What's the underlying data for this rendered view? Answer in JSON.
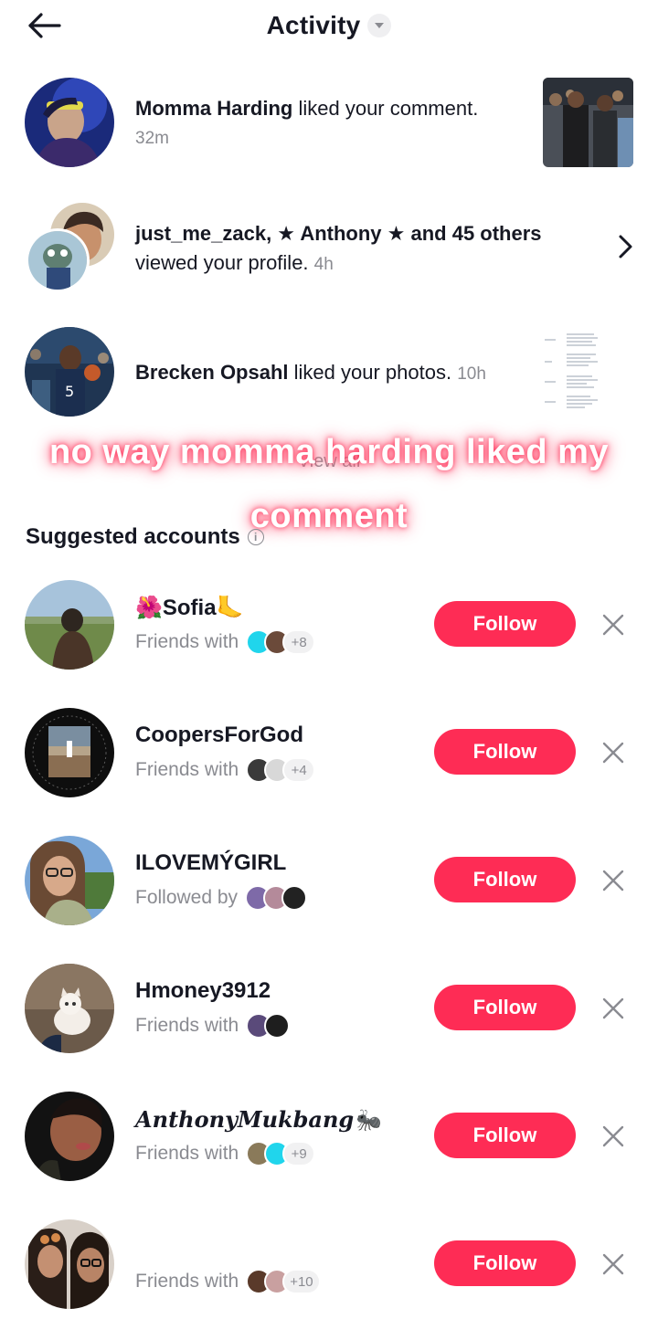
{
  "header": {
    "title": "Activity"
  },
  "activities": [
    {
      "name": "Momma Harding",
      "action": " liked your comment.",
      "time": "32m"
    },
    {
      "names": "just_me_zack, ★ Anthony ★ and 45 others",
      "action": "viewed your profile.",
      "time": "4h"
    },
    {
      "name": "Brecken Opsahl",
      "action": " liked your photos.",
      "time": "10h"
    }
  ],
  "overlay_caption": {
    "line1": "no way momma harding liked my",
    "line2": "comment"
  },
  "view_all": "View all",
  "suggested": {
    "title": "Suggested accounts",
    "follow_label": "Follow",
    "accounts": [
      {
        "name": "🌺Sofia🦶",
        "relation": "Friends with",
        "extra": "+8"
      },
      {
        "name": "CoopersForGod",
        "relation": "Friends with",
        "extra": "+4"
      },
      {
        "name": "ILOVEMÝGIRL",
        "relation": "Followed by",
        "extra": ""
      },
      {
        "name": "Hmoney3912",
        "relation": "Friends with",
        "extra": ""
      },
      {
        "name": "AnthonyMukbang🐜",
        "relation": "Friends with",
        "extra": "+9"
      },
      {
        "name": "",
        "relation": "Friends with",
        "extra": "+10"
      }
    ]
  },
  "colors": {
    "accent": "#fe2c55",
    "muted": "#8a8b91",
    "text": "#161823"
  },
  "icons": [
    "back-arrow-icon",
    "dropdown-caret-icon",
    "chevron-right-icon",
    "info-icon",
    "close-icon"
  ]
}
